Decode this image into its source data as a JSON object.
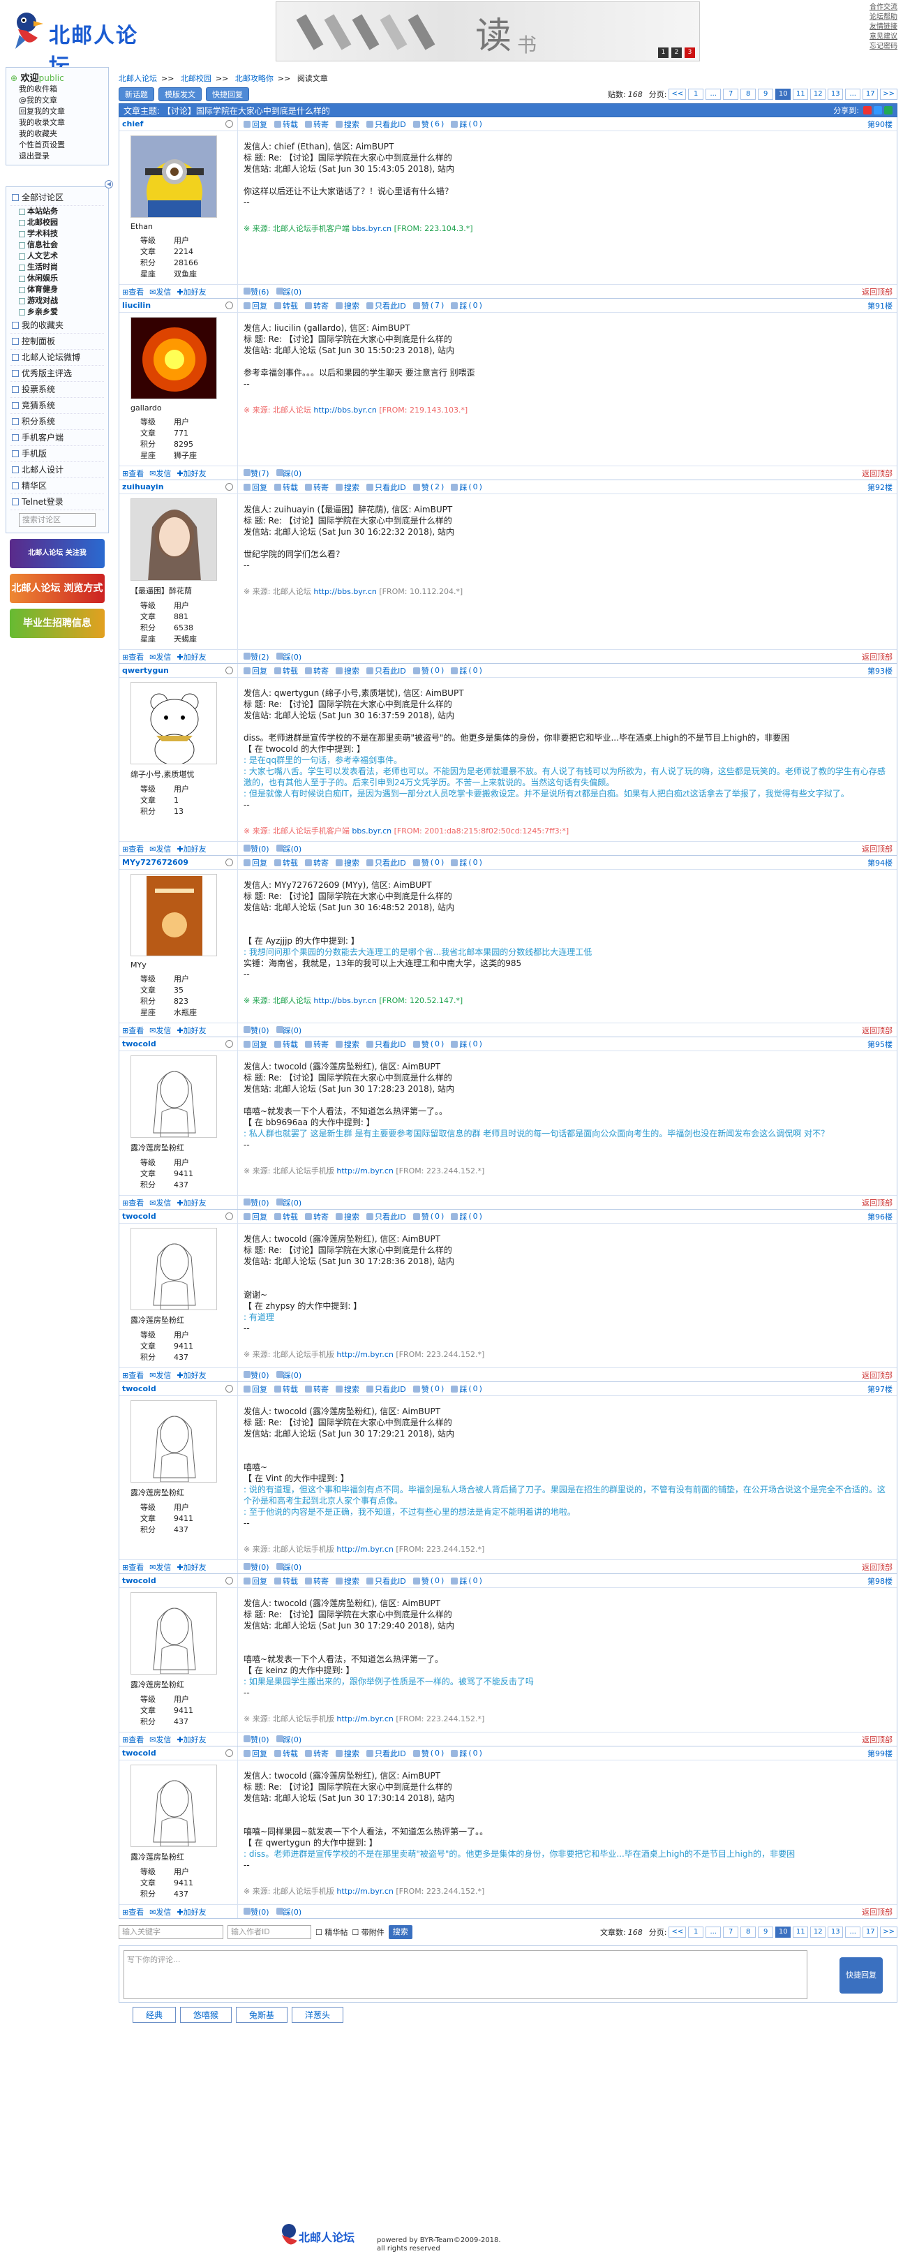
{
  "site": {
    "logo_text": "北邮人论坛"
  },
  "top_links": [
    "合作交流",
    "论坛帮助",
    "友情链接",
    "意见建议",
    "忘记密码"
  ],
  "banner": {
    "char": "读",
    "sub": "书",
    "dots": [
      "1",
      "2",
      "3"
    ]
  },
  "left": {
    "welcome": "欢迎",
    "user": "public",
    "user_links": [
      "我的收件箱",
      "@我的文章",
      "回复我的文章",
      "我的收录文章",
      "我的收藏夹",
      "个性首页设置",
      "退出登录"
    ],
    "all_boards": "全部讨论区",
    "boards": [
      "本站站务",
      "北邮校园",
      "学术科技",
      "信息社会",
      "人文艺术",
      "生活时尚",
      "休闲娱乐",
      "体育健身",
      "游戏对战",
      "乡亲乡爱"
    ],
    "sections": [
      "我的收藏夹",
      "控制面板",
      "北邮人论坛微博",
      "优秀版主评选",
      "投票系统",
      "竞猜系统",
      "积分系统",
      "手机客户端",
      "手机版",
      "北邮人设计",
      "精华区",
      "Telnet登录"
    ],
    "search_placeholder": "搜索讨论区",
    "ad1": "北邮人论坛 关注我",
    "ad2": "北邮人论坛 浏览方式",
    "ad3": "毕业生招聘信息"
  },
  "crumb": [
    "北邮人论坛",
    "北邮校园",
    "北邮攻略你",
    "阅读文章"
  ],
  "toolbar": {
    "new_post": "新话题",
    "post_by_template": "模版发文",
    "quick_reply": "快捷回复",
    "post_count_label": "贴数:",
    "post_count": "168",
    "pages_label": "分页:",
    "pages": [
      "<<",
      "1",
      "...",
      "7",
      "8",
      "9",
      "10",
      "11",
      "12",
      "13",
      "...",
      "17",
      ">>"
    ],
    "current_page": "10"
  },
  "thread": {
    "title": "文章主题: 【讨论】国际学院在大家心中到底是什么样的",
    "share": "分享到:"
  },
  "actions": {
    "reply": "回复",
    "forward": "转载",
    "repost": "转寄",
    "search": "搜索",
    "only_this": "只看此ID",
    "zan": "赞",
    "cai": "踩",
    "view": "查看",
    "mail": "发信",
    "addfriend": "加好友",
    "back_top": "返回顶部"
  },
  "stats_labels": {
    "level": "等级",
    "posts": "文章",
    "score": "积分",
    "star": "星座"
  },
  "posts": [
    {
      "user": "chief",
      "nick": "Ethan",
      "level": "用户",
      "posts": "2214",
      "score": "28166",
      "star": "双鱼座",
      "floor": "第90楼",
      "zan": "6",
      "cai": "0",
      "lines": [
        "发信人: chief (Ethan), 信区: AimBUPT",
        "标  题: Re: 【讨论】国际学院在大家心中到底是什么样的",
        "发信站: 北邮人论坛 (Sat Jun 30 15:43:05 2018), 站内"
      ],
      "body": [
        "你这样以后还让不让大家谐话了？！说心里话有什么错？",
        "--"
      ],
      "src_pre": "※ 来源: ",
      "src_client": "北邮人论坛手机客户端",
      "src_link": "bbs.byr.cn",
      "src_from": "[FROM: 223.104.3.*]",
      "src_type": "green"
    },
    {
      "user": "liucilin",
      "nick": "gallardo",
      "level": "用户",
      "posts": "771",
      "score": "8295",
      "star": "狮子座",
      "floor": "第91楼",
      "zan": "7",
      "cai": "0",
      "lines": [
        "发信人: liucilin (gallardo), 信区: AimBUPT",
        "标  题: Re: 【讨论】国际学院在大家心中到底是什么样的",
        "发信站: 北邮人论坛 (Sat Jun 30 15:50:23 2018), 站内"
      ],
      "body": [
        "参考幸福剑事件。。。以后和果园的学生聊天 要注意言行 别喂歪",
        "--"
      ],
      "src_pre": "※ 来源: ",
      "src_client": "北邮人论坛",
      "src_link": "http://bbs.byr.cn",
      "src_from": "[FROM: 219.143.103.*]",
      "src_type": "pink"
    },
    {
      "user": "zuihuayin",
      "nick": "【最逼困】醉花荫",
      "level": "用户",
      "posts": "881",
      "score": "6538",
      "star": "天蝎座",
      "floor": "第92楼",
      "zan": "2",
      "cai": "0",
      "lines": [
        "发信人: zuihuayin (【最逼困】醉花荫), 信区: AimBUPT",
        "标  题: Re: 【讨论】国际学院在大家心中到底是什么样的",
        "发信站: 北邮人论坛 (Sat Jun 30 16:22:32 2018), 站内"
      ],
      "body": [
        "世纪学院的同学们怎么看？",
        "--"
      ],
      "src_pre": "※ 来源: ",
      "src_client": "北邮人论坛",
      "src_link": "http://bbs.byr.cn",
      "src_from": "[FROM: 10.112.204.*]",
      "src_type": "plain"
    },
    {
      "user": "qwertygun",
      "nick": "绵子小号,素质堪忧",
      "level": "用户",
      "posts": "1",
      "score": "13",
      "star": "",
      "floor": "第93楼",
      "zan": "0",
      "cai": "0",
      "lines": [
        "发信人: qwertygun (绵子小号,素质堪忧), 信区: AimBUPT",
        "标  题: Re: 【讨论】国际学院在大家心中到底是什么样的",
        "发信站: 北邮人论坛 (Sat Jun 30 16:37:59 2018), 站内"
      ],
      "body": [
        "diss。老师进群是宣传学校的不是在那里卖萌\"被盗号\"的。他更多是集体的身份，你非要把它和毕业...毕在酒桌上high的不是节目上high的，非要困",
        "【 在 twocold 的大作中提到: 】"
      ],
      "quote": [
        ": 是在qq群里的一句话，参考幸福剑事件。",
        ": 大家七嘴八舌。学生可以发表看法，老师也可以。不能因为是老师就遭暴不放。有人说了有钱可以为所欲为，有人说了玩的嗨，这些都是玩笑的。老师说了教的学生有心存感激的，也有其他人至于子的。后来引申到24万文凭学历。不苦一上来就说的。当然这句话有失偏颇。",
        ": 但是就像人有时候说白痴IT，是因为遇到一部分zt人员吃掌卡要搬救设定。并不是说所有zt都是白痴。如果有人把白痴zt这话拿去了举报了，我觉得有些文字狱了。"
      ],
      "after": [
        "--"
      ],
      "src_pre": "※ 来源: ",
      "src_client": "北邮人论坛手机客户端",
      "src_link": "bbs.byr.cn",
      "src_from": "[FROM: 2001:da8:215:8f02:50cd:1245:7ff3:*]",
      "src_type": "pink"
    },
    {
      "user": "MYy727672609",
      "nick": "MYy",
      "level": "用户",
      "posts": "35",
      "score": "823",
      "star": "水瓶座",
      "floor": "第94楼",
      "zan": "0",
      "cai": "0",
      "lines": [
        "发信人: MYy727672609 (MYy), 信区: AimBUPT",
        "标  题: Re: 【讨论】国际学院在大家心中到底是什么样的",
        "发信站: 北邮人论坛 (Sat Jun 30 16:48:52 2018), 站内"
      ],
      "body": [
        "",
        "【 在 Ayzjjjp 的大作中提到: 】"
      ],
      "quote": [
        ": 我想问问那个果园的分数能去大连理工的是哪个省...我省北邮本果园的分数线都比大连理工低"
      ],
      "after": [
        "实锤：海南省，我就是，13年的我可以上大连理工和中南大学，这类的985",
        "--"
      ],
      "src_pre": "※ 来源: ",
      "src_client": "北邮人论坛",
      "src_link": "http://bbs.byr.cn",
      "src_from": "[FROM: 120.52.147.*]",
      "src_type": "green"
    },
    {
      "user": "twocold",
      "nick": "露冷莲房坠粉红",
      "level": "用户",
      "posts": "9411",
      "score": "437",
      "star": "",
      "floor": "第95楼",
      "zan": "0",
      "cai": "0",
      "lines": [
        "发信人: twocold (露冷莲房坠粉红), 信区: AimBUPT",
        "标  题: Re: 【讨论】国际学院在大家心中到底是什么样的",
        "发信站: 北邮人论坛 (Sat Jun 30 17:28:23 2018), 站内"
      ],
      "body": [
        "嘻嘻~就发表一下个人看法，不知道怎么热评第一了。。",
        "【 在 bb9696aa 的大作中提到: 】"
      ],
      "quote": [
        ": 私人群也就罢了 这是新生群 是有主要要参考国际留取信息的群 老师且时说的每一句话都是面向公众面向考生的。毕福剑也没在新闻发布会这么调侃啊 对不？"
      ],
      "after": [
        "--"
      ],
      "src_pre": "※ 来源: ",
      "src_client": "北邮人论坛手机版",
      "src_link": "http://m.byr.cn",
      "src_from": "[FROM: 223.244.152.*]",
      "src_type": "gray"
    },
    {
      "user": "twocold",
      "nick": "露冷莲房坠粉红",
      "level": "用户",
      "posts": "9411",
      "score": "437",
      "star": "",
      "floor": "第96楼",
      "zan": "0",
      "cai": "0",
      "lines": [
        "发信人: twocold (露冷莲房坠粉红), 信区: AimBUPT",
        "标  题: Re: 【讨论】国际学院在大家心中到底是什么样的",
        "发信站: 北邮人论坛 (Sat Jun 30 17:28:36 2018), 站内"
      ],
      "body": [
        "",
        "谢谢~",
        "【 在 zhypsy 的大作中提到: 】"
      ],
      "quote": [
        ": 有道理"
      ],
      "after": [
        "--"
      ],
      "src_pre": "※ 来源: ",
      "src_client": "北邮人论坛手机版",
      "src_link": "http://m.byr.cn",
      "src_from": "[FROM: 223.244.152.*]",
      "src_type": "gray"
    },
    {
      "user": "twocold",
      "nick": "露冷莲房坠粉红",
      "level": "用户",
      "posts": "9411",
      "score": "437",
      "star": "",
      "floor": "第97楼",
      "zan": "0",
      "cai": "0",
      "lines": [
        "发信人: twocold (露冷莲房坠粉红), 信区: AimBUPT",
        "标  题: Re: 【讨论】国际学院在大家心中到底是什么样的",
        "发信站: 北邮人论坛 (Sat Jun 30 17:29:21 2018), 站内"
      ],
      "body": [
        "",
        "嘻嘻~",
        "【 在 Vint 的大作中提到: 】"
      ],
      "quote": [
        ": 说的有道理，但这个事和毕福剑有点不同。毕福剑是私人场合被人背后捅了刀子。果园是在招生的群里说的，不管有没有前面的铺垫，在公开场合说这个是完全不合适的。这个孙是和高考生起到北京人家个事有点像。",
        ": 至于他说的内容是不是正确，我不知道，不过有些心里的想法是肯定不能明着讲的地啦。"
      ],
      "after": [
        "--"
      ],
      "src_pre": "※ 来源: ",
      "src_client": "北邮人论坛手机版",
      "src_link": "http://m.byr.cn",
      "src_from": "[FROM: 223.244.152.*]",
      "src_type": "gray"
    },
    {
      "user": "twocold",
      "nick": "露冷莲房坠粉红",
      "level": "用户",
      "posts": "9411",
      "score": "437",
      "star": "",
      "floor": "第98楼",
      "zan": "0",
      "cai": "0",
      "lines": [
        "发信人: twocold (露冷莲房坠粉红), 信区: AimBUPT",
        "标  题: Re: 【讨论】国际学院在大家心中到底是什么样的",
        "发信站: 北邮人论坛 (Sat Jun 30 17:29:40 2018), 站内"
      ],
      "body": [
        "",
        "嘻嘻~就发表一下个人看法，不知道怎么热评第一了。",
        "【 在 keinz 的大作中提到: 】"
      ],
      "quote": [
        ": 如果是果园学生搬出来的，跟你举例子性质是不一样的。被骂了不能反击了吗"
      ],
      "after": [
        "--"
      ],
      "src_pre": "※ 来源: ",
      "src_client": "北邮人论坛手机版",
      "src_link": "http://m.byr.cn",
      "src_from": "[FROM: 223.244.152.*]",
      "src_type": "gray"
    },
    {
      "user": "twocold",
      "nick": "露冷莲房坠粉红",
      "level": "用户",
      "posts": "9411",
      "score": "437",
      "star": "",
      "floor": "第99楼",
      "zan": "0",
      "cai": "0",
      "lines": [
        "发信人: twocold (露冷莲房坠粉红), 信区: AimBUPT",
        "标  题: Re: 【讨论】国际学院在大家心中到底是什么样的",
        "发信站: 北邮人论坛 (Sat Jun 30 17:30:14 2018), 站内"
      ],
      "body": [
        "",
        "嘻嘻~同样果园~就发表一下个人看法，不知道怎么热评第一了。。",
        "【 在 qwertygun 的大作中提到: 】"
      ],
      "quote": [
        ": diss。老师进群是宣传学校的不是在那里卖萌\"被盗号\"的。他更多是集体的身份，你非要把它和毕业...毕在酒桌上high的不是节目上high的，非要困"
      ],
      "after": [
        "--"
      ],
      "src_pre": "※ 来源: ",
      "src_client": "北邮人论坛手机版",
      "src_link": "http://m.byr.cn",
      "src_from": "[FROM: 223.244.152.*]",
      "src_type": "gray"
    }
  ],
  "bottom": {
    "kw_placeholder": "输入关键字",
    "author_placeholder": "输入作者ID",
    "digest": "精华帖",
    "attach": "带附件",
    "search_btn": "搜索",
    "count_label": "文章数:",
    "count": "168",
    "pages_label": "分页:"
  },
  "reply": {
    "placeholder": "写下你的评论...",
    "send": "快捷回复",
    "emos": [
      "经典",
      "悠嘻猴",
      "兔斯基",
      "洋葱头"
    ]
  },
  "footer": {
    "l1": "powered by BYR-Team©2009-2018.",
    "l2": "all rights reserved"
  },
  "colors": {
    "accent": "#3b78cc",
    "quote": "#2a9ad0",
    "from_green": "#1aa04a",
    "from_pink": "#e66"
  }
}
